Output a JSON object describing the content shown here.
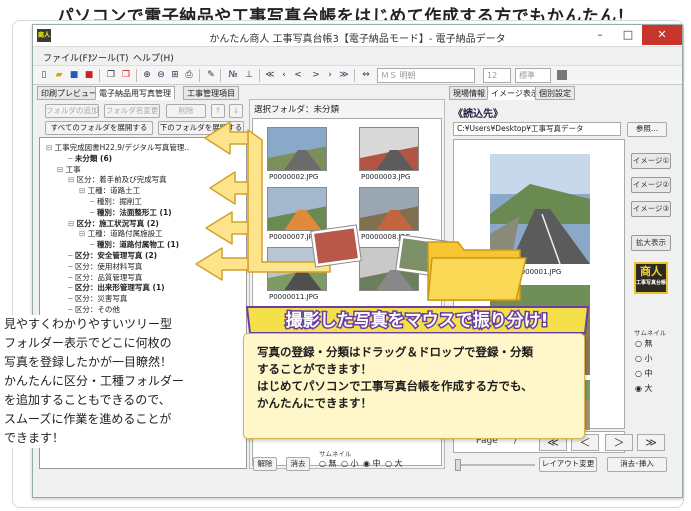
{
  "headline": "パソコンで電子納品や工事写真台帳をはじめて作成する方でもかんたん！",
  "window": {
    "app_icon": "商人",
    "title": "かんたん商人 工事写真台帳3【電子納品モード】- 電子納品データ",
    "min": "–",
    "max": "□",
    "close": "✕"
  },
  "menu": [
    "ファイル(F)",
    "ツール(T)",
    "ヘルプ(H)"
  ],
  "toolbar": {
    "zoom_glyph": "№",
    "font_name": "ＭＳ 明朝",
    "font_size": "12",
    "font_style": "標準"
  },
  "left_tabs": [
    "印刷プレビュー",
    "電子納品用写真管理",
    "工事管理項目"
  ],
  "folder_buttons": {
    "add": "フォルダの追加",
    "rename": "フォルダ名変更",
    "delete": "削除",
    "up": "↑",
    "down": "↓"
  },
  "expand_buttons": {
    "expand_all": "すべてのフォルダを展開する",
    "expand_lower": "下のフォルダを展開する"
  },
  "tree": [
    {
      "label": "工事完成図書H22.9/デジタル写真管理..",
      "level": 0,
      "bold": false,
      "prefix": "⊟"
    },
    {
      "label": "未分類 (6)",
      "level": 2,
      "bold": true,
      "prefix": "─"
    },
    {
      "label": "工事",
      "level": 1,
      "bold": false,
      "prefix": "⊟"
    },
    {
      "label": "区分：着手前及び完成写真",
      "level": 2,
      "bold": false,
      "prefix": "⊟"
    },
    {
      "label": "工種：道路土工",
      "level": 3,
      "bold": false,
      "prefix": "⊟"
    },
    {
      "label": "種別：掘削工",
      "level": 4,
      "bold": false,
      "prefix": "─"
    },
    {
      "label": "種別：法面整形工 (1)",
      "level": 4,
      "bold": true,
      "prefix": "─"
    },
    {
      "label": "区分：施工状況写真 (2)",
      "level": 2,
      "bold": true,
      "prefix": "⊟"
    },
    {
      "label": "工種：道路付属施設工",
      "level": 3,
      "bold": false,
      "prefix": "⊟"
    },
    {
      "label": "種別：道路付属物工 (1)",
      "level": 4,
      "bold": true,
      "prefix": "─"
    },
    {
      "label": "区分：安全管理写真 (2)",
      "level": 2,
      "bold": true,
      "prefix": "─"
    },
    {
      "label": "区分：使用材料写真",
      "level": 2,
      "bold": false,
      "prefix": "─"
    },
    {
      "label": "区分：品質管理写真",
      "level": 2,
      "bold": false,
      "prefix": "─"
    },
    {
      "label": "区分：出来形管理写真 (1)",
      "level": 2,
      "bold": true,
      "prefix": "─"
    },
    {
      "label": "区分：災害写真",
      "level": 2,
      "bold": false,
      "prefix": "─"
    },
    {
      "label": "区分：その他",
      "level": 2,
      "bold": false,
      "prefix": "─"
    }
  ],
  "middle": {
    "selected_folder": "選択フォルダ：未分類",
    "thumbs": [
      "P0000002.JPG",
      "P0000003.JPG",
      "P0000007.JPG",
      "P0000008.JPG",
      "P0000011.JPG",
      ""
    ]
  },
  "bottom_left": {
    "release": "解除",
    "clear": "消去",
    "thumbnail_label": "サムネイル",
    "options": [
      "無",
      "小",
      "中",
      "大"
    ],
    "selected": "中"
  },
  "right_tabs": [
    "現場情報",
    "イメージ表示",
    "個別設定"
  ],
  "right": {
    "load_from": "《読込先》",
    "path": "C:¥Users¥Desktop¥工事写真データ",
    "browse": "参照...",
    "main_thumb": "P0000001.JPG",
    "page_label": "Page",
    "page_sep": "/"
  },
  "side_buttons": [
    "イメージ①",
    "イメージ②",
    "イメージ③",
    "拡大表示"
  ],
  "brand_badge": {
    "line1": "商人",
    "line2": "工事写真台帳"
  },
  "right_thumb": {
    "label": "サムネイル",
    "options": [
      "無",
      "小",
      "中",
      "大"
    ],
    "selected": "大"
  },
  "nav_buttons": [
    "≪",
    "＜",
    "＞",
    "≫"
  ],
  "bottom_right": {
    "layout": "レイアウト変更",
    "delete_insert": "消去･挿入"
  },
  "banner": "撮影した写真をマウスで振り分け!",
  "callout": [
    "写真の登録・分類はドラッグ＆ドロップで登録・分類",
    "することができます！",
    "はじめてパソコンで工事写真台帳を作成する方でも、",
    "かんたんにできます！"
  ],
  "left_note": [
    "見やすくわかりやすいツリー型",
    "フォルダー表示でどこに何枚の",
    "写真を登録したかが一目瞭然！",
    "かんたんに区分・工種フォルダー",
    "を追加することもできるので、",
    "スムーズに作業を進めることが",
    "できます！"
  ],
  "colors": {
    "arrow_fill": "#fde48a",
    "arrow_stroke": "#d2a12c",
    "banner_fill": "#f4e04a",
    "banner_text": "#6a3fa0",
    "folder": "#f6c531",
    "close": "#c8352b"
  }
}
